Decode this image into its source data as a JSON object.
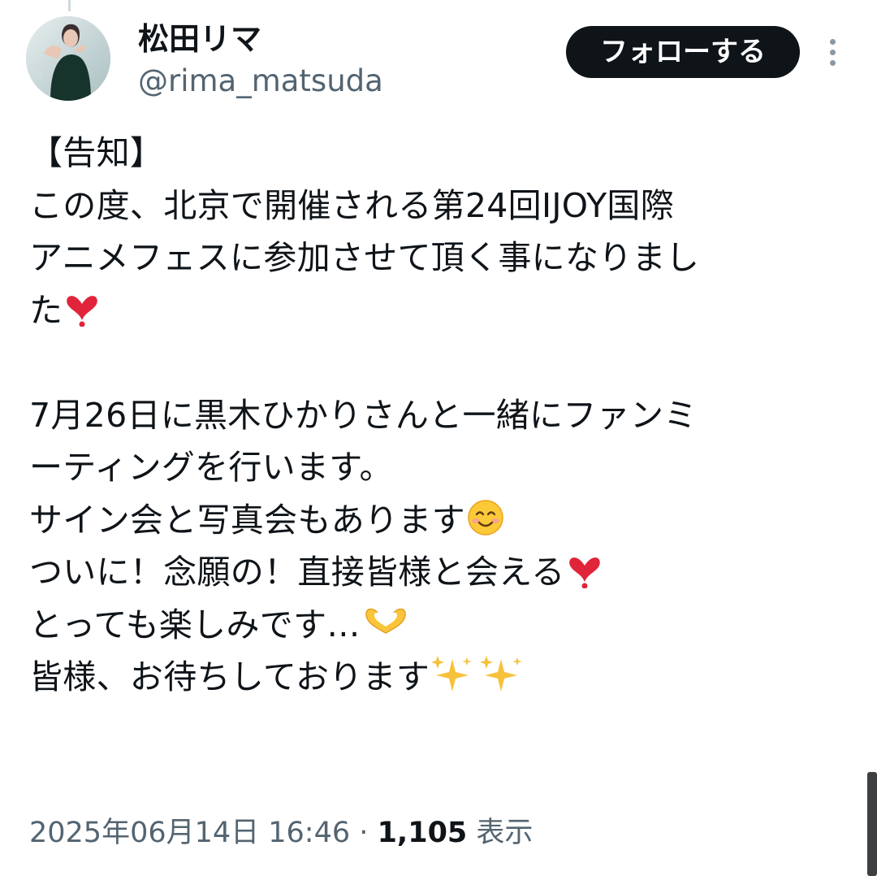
{
  "author": {
    "display_name": "松田リマ",
    "handle": "@rima_matsuda"
  },
  "header": {
    "follow_label": "フォローする"
  },
  "tweet": {
    "lines": [
      "【告知】",
      "この度、北京で開催される第24回IJOY国際",
      "アニメフェスに参加させて頂く事になりまし",
      "た",
      "",
      "7月26日に黒木ひかりさんと一緒にファンミ",
      "ーティングを行います。",
      "サイン会と写真会もあります",
      "ついに！念願の！直接皆様と会える",
      "とっても楽しみです…",
      "皆様、お待ちしております"
    ],
    "emoji": {
      "line_4": "red-heart-emoji",
      "line_8": "smiling-face-emoji",
      "line_9": "red-heart-emoji",
      "line_10": "heart-hands-emoji",
      "line_11": "sparkles-emoji"
    }
  },
  "meta": {
    "timestamp": "2025年06月14日 16:46",
    "separator": "·",
    "views_count": "1,105",
    "views_label": "表示"
  },
  "colors": {
    "text": "#0f1419",
    "secondary_text": "#536471",
    "button_bg": "#0f1419",
    "heart": "#e0243a",
    "sparkle": "#f6c13b"
  }
}
